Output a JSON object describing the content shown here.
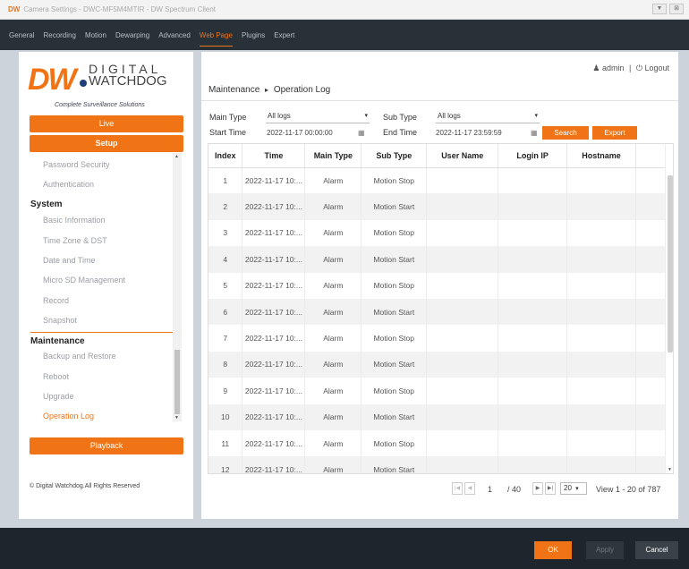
{
  "window": {
    "brand": "DW",
    "title": "Camera Settings - DWC-MF5M4MTIR - DW Spectrum Client",
    "buttons": [
      "▼",
      "⊠"
    ]
  },
  "topnav": {
    "tabs": [
      {
        "label": "General",
        "active": false
      },
      {
        "label": "Recording",
        "active": false
      },
      {
        "label": "Motion",
        "active": false
      },
      {
        "label": "Dewarping",
        "active": false
      },
      {
        "label": "Advanced",
        "active": false
      },
      {
        "label": "Web Page",
        "active": true
      },
      {
        "label": "Plugins",
        "active": false
      },
      {
        "label": "Expert",
        "active": false
      }
    ]
  },
  "logo": {
    "mark": "DW",
    "line1": "DIGITAL",
    "line2": "WATCHDOG",
    "tagline": "Complete Surveillance Solutions"
  },
  "sidebar": {
    "live_label": "Live",
    "setup_label": "Setup",
    "playback_label": "Playback",
    "items": [
      {
        "label": "Password Security",
        "type": "item"
      },
      {
        "label": "Authentication",
        "type": "item"
      },
      {
        "label": "System",
        "type": "section"
      },
      {
        "label": "Basic Information",
        "type": "item"
      },
      {
        "label": "Time Zone & DST",
        "type": "item"
      },
      {
        "label": "Date and Time",
        "type": "item"
      },
      {
        "label": "Micro SD Management",
        "type": "item"
      },
      {
        "label": "Record",
        "type": "item"
      },
      {
        "label": "Snapshot",
        "type": "item"
      },
      {
        "label": "Maintenance",
        "type": "section"
      },
      {
        "label": "Backup and Restore",
        "type": "item"
      },
      {
        "label": "Reboot",
        "type": "item"
      },
      {
        "label": "Upgrade",
        "type": "item"
      },
      {
        "label": "Operation Log",
        "type": "selected"
      }
    ],
    "copyright": "© Digital Watchdog.All Rights Reserved"
  },
  "header": {
    "user_icon": "user-icon",
    "username": "admin",
    "separator": "|",
    "logout_icon": "power-icon",
    "logout_label": "Logout",
    "breadcrumb_parent": "Maintenance",
    "breadcrumb_arrow": "▸",
    "breadcrumb_current": "Operation Log"
  },
  "filters": {
    "main_type_label": "Main Type",
    "main_type_value": "All logs",
    "sub_type_label": "Sub Type",
    "sub_type_value": "All logs",
    "start_time_label": "Start Time",
    "start_time_value": "2022-11-17 00:00:00",
    "end_time_label": "End Time",
    "end_time_value": "2022-11-17 23:59:59",
    "search_label": "Search",
    "export_label": "Export"
  },
  "table": {
    "columns": [
      "Index",
      "Time",
      "Main Type",
      "Sub Type",
      "User Name",
      "Login IP",
      "Hostname"
    ],
    "rows": [
      [
        "1",
        "2022-11-17 10:...",
        "Alarm",
        "Motion Stop",
        "",
        "",
        ""
      ],
      [
        "2",
        "2022-11-17 10:...",
        "Alarm",
        "Motion Start",
        "",
        "",
        ""
      ],
      [
        "3",
        "2022-11-17 10:...",
        "Alarm",
        "Motion Stop",
        "",
        "",
        ""
      ],
      [
        "4",
        "2022-11-17 10:...",
        "Alarm",
        "Motion Start",
        "",
        "",
        ""
      ],
      [
        "5",
        "2022-11-17 10:...",
        "Alarm",
        "Motion Stop",
        "",
        "",
        ""
      ],
      [
        "6",
        "2022-11-17 10:...",
        "Alarm",
        "Motion Start",
        "",
        "",
        ""
      ],
      [
        "7",
        "2022-11-17 10:...",
        "Alarm",
        "Motion Stop",
        "",
        "",
        ""
      ],
      [
        "8",
        "2022-11-17 10:...",
        "Alarm",
        "Motion Start",
        "",
        "",
        ""
      ],
      [
        "9",
        "2022-11-17 10:...",
        "Alarm",
        "Motion Stop",
        "",
        "",
        ""
      ],
      [
        "10",
        "2022-11-17 10:...",
        "Alarm",
        "Motion Start",
        "",
        "",
        ""
      ],
      [
        "11",
        "2022-11-17 10:...",
        "Alarm",
        "Motion Stop",
        "",
        "",
        ""
      ],
      [
        "12",
        "2022-11-17 10:...",
        "Alarm",
        "Motion Start",
        "",
        "",
        ""
      ]
    ]
  },
  "pager": {
    "current_page": "1",
    "total_pages": "/ 40",
    "page_size": "20",
    "view_text": "View 1 - 20 of 787"
  },
  "footer": {
    "ok_label": "OK",
    "apply_label": "Apply",
    "cancel_label": "Cancel"
  },
  "colors": {
    "accent": "#f07416",
    "nav_bg": "#283038",
    "page_bg": "#cdd3db"
  }
}
